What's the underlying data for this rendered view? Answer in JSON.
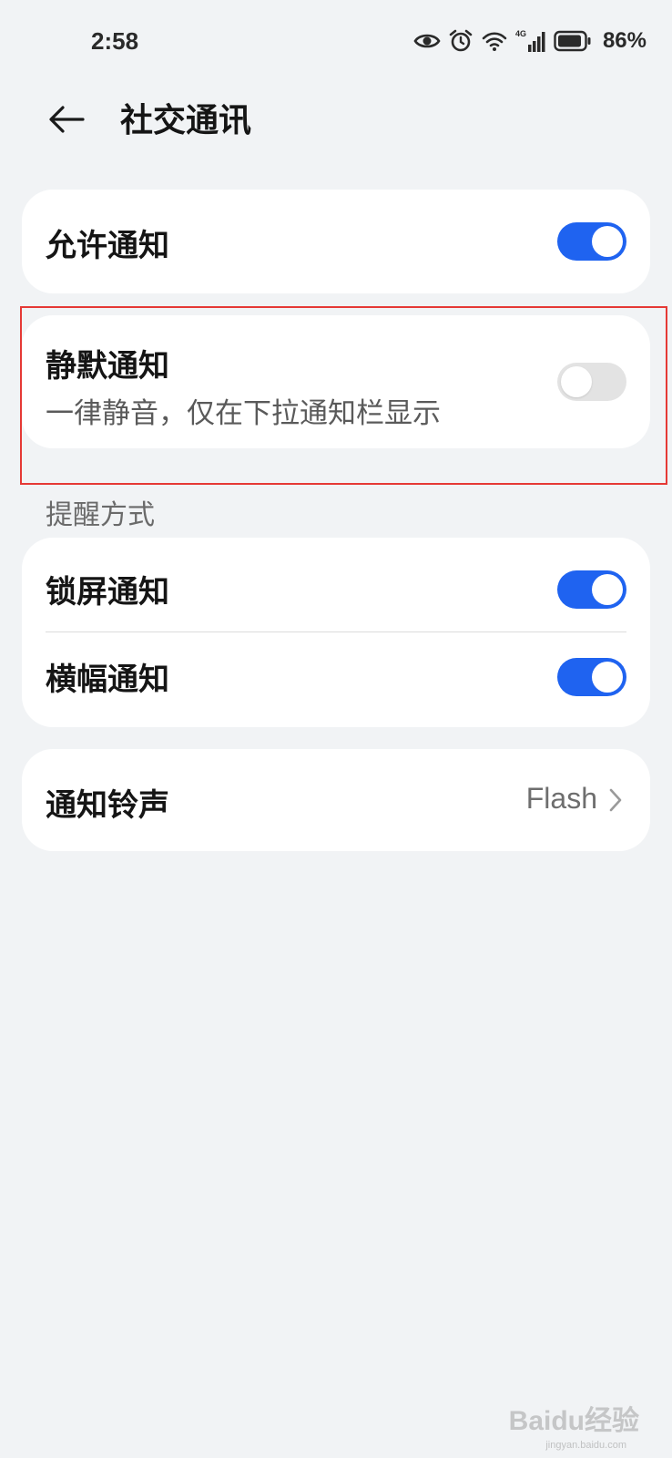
{
  "status_bar": {
    "time": "2:58",
    "battery_percent": "86%",
    "network_label": "4G",
    "icons": [
      "eye-icon",
      "alarm-icon",
      "wifi-icon",
      "cellular-signal-icon",
      "battery-icon"
    ]
  },
  "header": {
    "title": "社交通讯",
    "back_icon": "arrow-left-icon"
  },
  "settings": {
    "allow_notifications": {
      "label": "允许通知",
      "enabled": true
    },
    "silent_notifications": {
      "label": "静默通知",
      "description": "一律静音，仅在下拉通知栏显示",
      "enabled": false
    },
    "alert_section_label": "提醒方式",
    "lock_screen": {
      "label": "锁屏通知",
      "enabled": true
    },
    "banner": {
      "label": "横幅通知",
      "enabled": true
    },
    "ringtone": {
      "label": "通知铃声",
      "value": "Flash"
    }
  },
  "watermark": {
    "text": "Baidu经验",
    "sub": "jingyan.baidu.com"
  },
  "colors": {
    "accent": "#1f63f0",
    "background": "#f1f3f5",
    "card": "#ffffff",
    "highlight": "#e53935"
  }
}
